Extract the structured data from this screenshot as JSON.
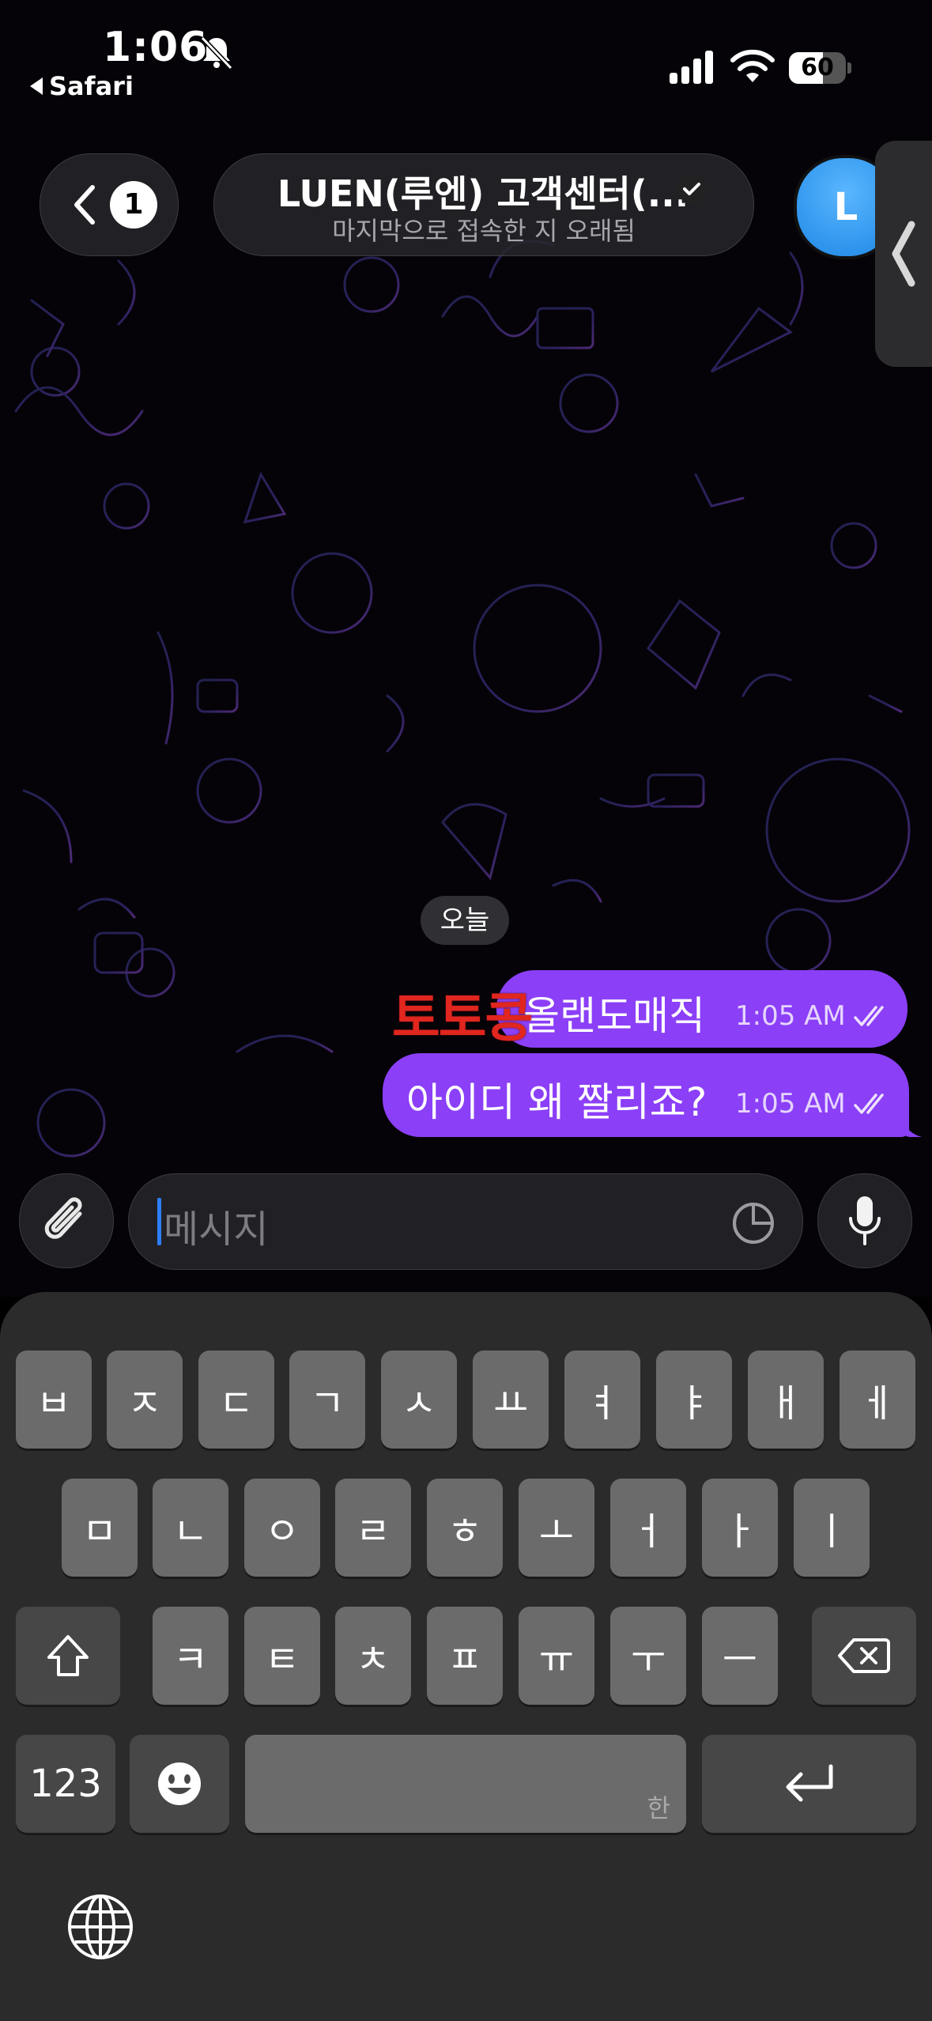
{
  "status_bar": {
    "time": "1:06",
    "back_app": "Safari",
    "battery_level": "60",
    "battery_fraction": 0.6,
    "icons": [
      "bell-slash-icon",
      "signal-icon",
      "wifi-icon",
      "battery-icon"
    ]
  },
  "header": {
    "unread_count": "1",
    "title": "LUEN(루엔) 고객센터(...",
    "subtitle": "마지막으로 접속한 지 오래됨",
    "avatar_letter": "L",
    "avatar_color": "#2196f3",
    "verified_icon": "verified-badge-icon"
  },
  "chat": {
    "date_label": "오늘",
    "sticker_text": "토토콩",
    "messages": [
      {
        "text": "올랜도매직",
        "time": "1:05 AM",
        "status": "read"
      },
      {
        "text": "아이디 왜 짤리죠?",
        "time": "1:05 AM",
        "status": "read"
      }
    ],
    "bubble_color": "#8b3ff7"
  },
  "composer": {
    "placeholder": "메시지",
    "icons": [
      "paperclip-icon",
      "sticker-icon",
      "mic-icon"
    ]
  },
  "keyboard": {
    "row1": [
      "ㅂ",
      "ㅈ",
      "ㄷ",
      "ㄱ",
      "ㅅ",
      "ㅛ",
      "ㅕ",
      "ㅑ",
      "ㅐ",
      "ㅔ"
    ],
    "row2": [
      "ㅁ",
      "ㄴ",
      "ㅇ",
      "ㄹ",
      "ㅎ",
      "ㅗ",
      "ㅓ",
      "ㅏ",
      "ㅣ"
    ],
    "row3": [
      "ㅋ",
      "ㅌ",
      "ㅊ",
      "ㅍ",
      "ㅠ",
      "ㅜ",
      "ㅡ"
    ],
    "numbers_label": "123",
    "space_hint": "한"
  }
}
